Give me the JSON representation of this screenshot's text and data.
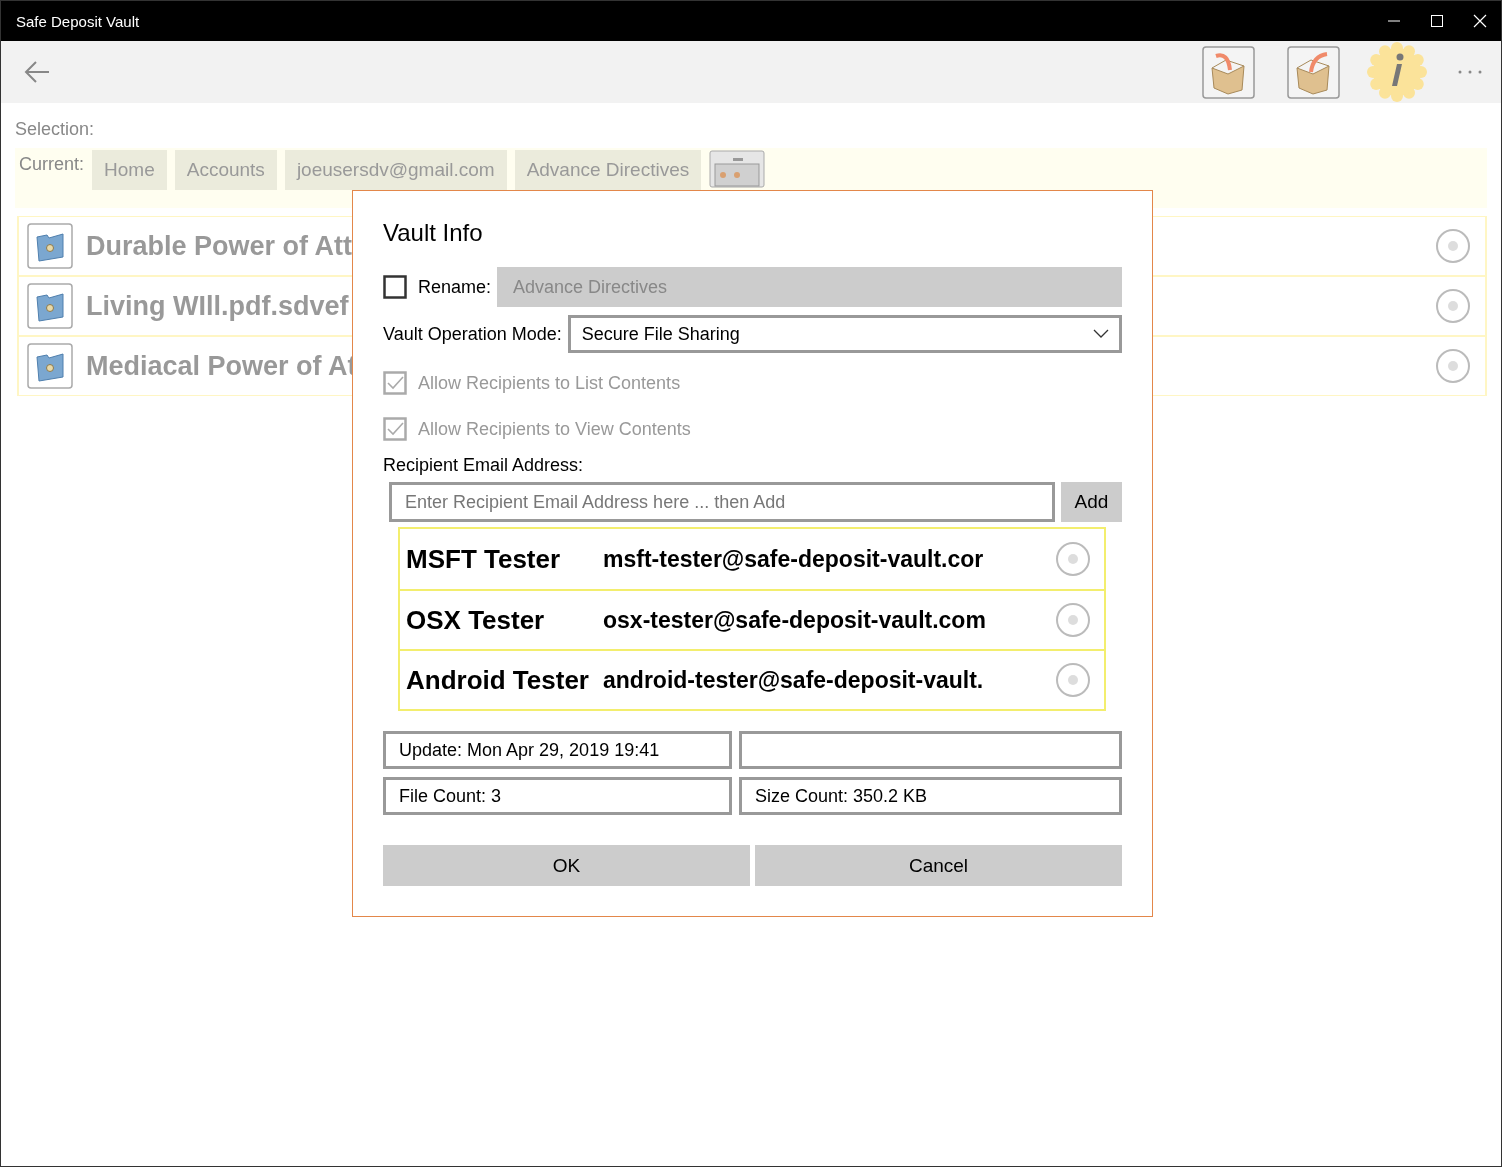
{
  "window": {
    "title": "Safe Deposit Vault"
  },
  "selection_label": "Selection:",
  "breadcrumb": {
    "label": "Current:",
    "items": [
      "Home",
      "Accounts",
      "joeusersdv@gmail.com",
      "Advance Directives"
    ]
  },
  "files": [
    {
      "name": "Durable Power of Att",
      "selected": false
    },
    {
      "name": "Living WIll.pdf.sdvef",
      "selected": false
    },
    {
      "name": "Mediacal Power of At",
      "selected": false
    }
  ],
  "dialog": {
    "title": "Vault Info",
    "rename": {
      "label": "Rename:",
      "checked": false,
      "value": "Advance Directives"
    },
    "mode": {
      "label": "Vault Operation Mode:",
      "value": "Secure File Sharing"
    },
    "options": [
      {
        "label": "Allow Recipients to List Contents",
        "checked": true,
        "disabled": true
      },
      {
        "label": "Allow Recipients to View Contents",
        "checked": true,
        "disabled": true
      }
    ],
    "recipients_label": "Recipient Email Address:",
    "email_field": {
      "placeholder": "Enter Recipient Email Address here ... then Add"
    },
    "add_button": "Add",
    "recipients": [
      {
        "name": "MSFT Tester",
        "email": "msft-tester@safe-deposit-vault.cor",
        "selected": false
      },
      {
        "name": "OSX Tester",
        "email": "osx-tester@safe-deposit-vault.com",
        "selected": false
      },
      {
        "name": "Android Tester",
        "email": "android-tester@safe-deposit-vault.",
        "selected": false
      }
    ],
    "info": [
      {
        "kind": "text",
        "text": "Update: Mon Apr 29, 2019 19:41"
      },
      {
        "kind": "empty"
      },
      {
        "kind": "text",
        "text": "File Count: 3"
      },
      {
        "kind": "text",
        "text": "Size Count: 350.2 KB"
      }
    ],
    "buttons": [
      "OK",
      "Cancel"
    ]
  }
}
